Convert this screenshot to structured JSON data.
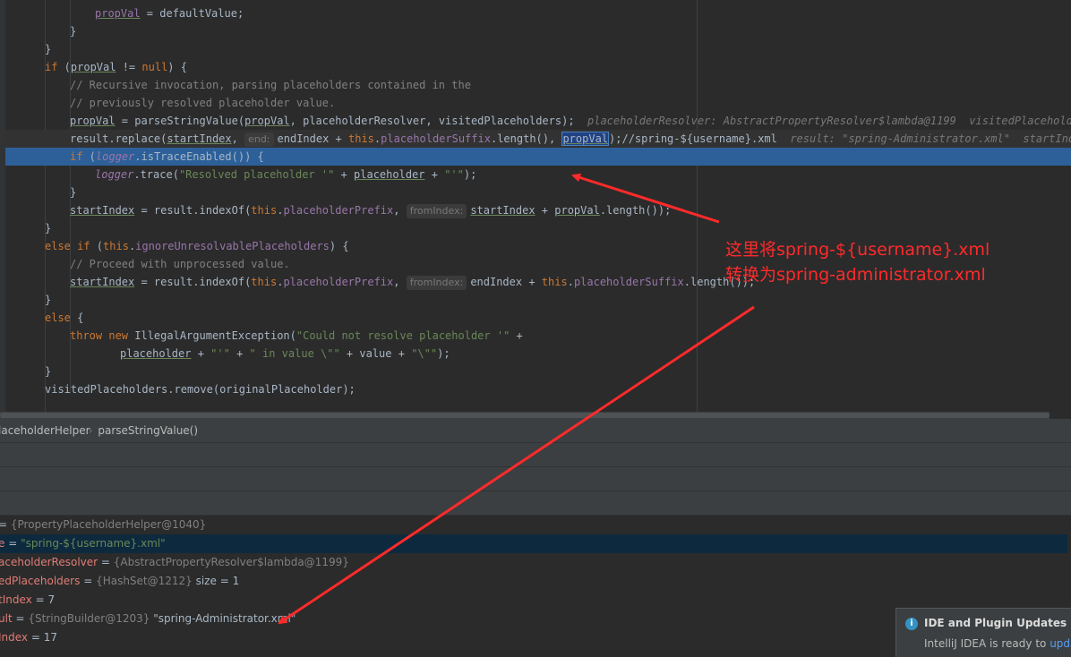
{
  "editor": {
    "lines": [
      {
        "indent": 4,
        "html_parts": [
          {
            "t": "propVal",
            "cls": "f u"
          },
          {
            "t": " = defaultValue;",
            "cls": ""
          }
        ]
      },
      {
        "indent": 3,
        "html_parts": [
          {
            "t": "}",
            "cls": ""
          }
        ]
      },
      {
        "indent": 2,
        "html_parts": [
          {
            "t": "}",
            "cls": ""
          }
        ]
      },
      {
        "indent": 2,
        "html_parts": [
          {
            "t": "if",
            "cls": "k"
          },
          {
            "t": " (",
            "cls": ""
          },
          {
            "t": "propVal",
            "cls": "u"
          },
          {
            "t": " != ",
            "cls": ""
          },
          {
            "t": "null",
            "cls": "k"
          },
          {
            "t": ") {",
            "cls": ""
          }
        ]
      },
      {
        "indent": 3,
        "html_parts": [
          {
            "t": "// Recursive invocation, parsing placeholders contained in the",
            "cls": "c"
          }
        ]
      },
      {
        "indent": 3,
        "html_parts": [
          {
            "t": "// previously resolved placeholder value.",
            "cls": "c"
          }
        ]
      },
      {
        "indent": 3,
        "html_parts": [
          {
            "t": "propVal",
            "cls": "u"
          },
          {
            "t": " = parseStringValue(",
            "cls": ""
          },
          {
            "t": "propVal",
            "cls": "u"
          },
          {
            "t": ", placeholderResolver, visitedPlaceholders);",
            "cls": ""
          },
          {
            "t": "  placeholderResolver: AbstractPropertyResolver$lambda@1199  visitedPlaceholders: ",
            "cls": "inline-val"
          }
        ]
      },
      {
        "indent": 3,
        "html_parts": [
          {
            "t": "result.replace(",
            "cls": ""
          },
          {
            "t": "startIndex",
            "cls": "u"
          },
          {
            "t": ", ",
            "cls": ""
          },
          {
            "hint": "end:"
          },
          {
            "t": "endIndex + ",
            "cls": ""
          },
          {
            "t": "this",
            "cls": "k"
          },
          {
            "t": ".",
            "cls": ""
          },
          {
            "t": "placeholderSuffix",
            "cls": "f"
          },
          {
            "t": ".length(), ",
            "cls": ""
          },
          {
            "t": "propVal",
            "cls": "u sel"
          },
          {
            "t": ");//spring-${username}.xml",
            "cls": ""
          },
          {
            "t": "  result: \"spring-Administrator.xml\"  startIndex: ",
            "cls": "inline-val"
          }
        ]
      },
      {
        "indent": 3,
        "html_parts": [
          {
            "t": "if",
            "cls": "k"
          },
          {
            "t": " (",
            "cls": ""
          },
          {
            "t": "logger",
            "cls": "fi"
          },
          {
            "t": ".isTraceEnabled()) {",
            "cls": ""
          }
        ]
      },
      {
        "indent": 4,
        "html_parts": [
          {
            "t": "logger",
            "cls": "fi"
          },
          {
            "t": ".trace(",
            "cls": ""
          },
          {
            "t": "\"Resolved placeholder '\"",
            "cls": "s"
          },
          {
            "t": " + ",
            "cls": ""
          },
          {
            "t": "placeholder",
            "cls": "u"
          },
          {
            "t": " + ",
            "cls": ""
          },
          {
            "t": "\"'\"",
            "cls": "s"
          },
          {
            "t": ");",
            "cls": ""
          }
        ]
      },
      {
        "indent": 3,
        "html_parts": [
          {
            "t": "}",
            "cls": ""
          }
        ]
      },
      {
        "indent": 3,
        "html_parts": [
          {
            "t": "startIndex",
            "cls": "u"
          },
          {
            "t": " = result.indexOf(",
            "cls": ""
          },
          {
            "t": "this",
            "cls": "k"
          },
          {
            "t": ".",
            "cls": ""
          },
          {
            "t": "placeholderPrefix",
            "cls": "f"
          },
          {
            "t": ", ",
            "cls": ""
          },
          {
            "hint": "fromIndex:"
          },
          {
            "t": "startIndex",
            "cls": "u"
          },
          {
            "t": " + ",
            "cls": ""
          },
          {
            "t": "propVal",
            "cls": "u"
          },
          {
            "t": ".length());",
            "cls": ""
          }
        ]
      },
      {
        "indent": 2,
        "html_parts": [
          {
            "t": "}",
            "cls": ""
          }
        ]
      },
      {
        "indent": 2,
        "html_parts": [
          {
            "t": "else if",
            "cls": "k"
          },
          {
            "t": " (",
            "cls": ""
          },
          {
            "t": "this",
            "cls": "k"
          },
          {
            "t": ".",
            "cls": ""
          },
          {
            "t": "ignoreUnresolvablePlaceholders",
            "cls": "f"
          },
          {
            "t": ") {",
            "cls": ""
          }
        ]
      },
      {
        "indent": 3,
        "html_parts": [
          {
            "t": "// Proceed with unprocessed value.",
            "cls": "c"
          }
        ]
      },
      {
        "indent": 3,
        "html_parts": [
          {
            "t": "startIndex",
            "cls": "u"
          },
          {
            "t": " = result.indexOf(",
            "cls": ""
          },
          {
            "t": "this",
            "cls": "k"
          },
          {
            "t": ".",
            "cls": ""
          },
          {
            "t": "placeholderPrefix",
            "cls": "f"
          },
          {
            "t": ", ",
            "cls": ""
          },
          {
            "hint": "fromIndex:"
          },
          {
            "t": "endIndex + ",
            "cls": ""
          },
          {
            "t": "this",
            "cls": "k"
          },
          {
            "t": ".",
            "cls": ""
          },
          {
            "t": "placeholderSuffix",
            "cls": "f"
          },
          {
            "t": ".length());",
            "cls": ""
          }
        ]
      },
      {
        "indent": 2,
        "html_parts": [
          {
            "t": "}",
            "cls": ""
          }
        ]
      },
      {
        "indent": 2,
        "html_parts": [
          {
            "t": "else",
            "cls": "k"
          },
          {
            "t": " {",
            "cls": ""
          }
        ]
      },
      {
        "indent": 3,
        "html_parts": [
          {
            "t": "throw new",
            "cls": "k"
          },
          {
            "t": " IllegalArgumentException(",
            "cls": ""
          },
          {
            "t": "\"Could not resolve placeholder '\"",
            "cls": "s"
          },
          {
            "t": " +",
            "cls": ""
          }
        ]
      },
      {
        "indent": 5,
        "html_parts": [
          {
            "t": "placeholder",
            "cls": "u"
          },
          {
            "t": " + ",
            "cls": ""
          },
          {
            "t": "\"'\"",
            "cls": "s"
          },
          {
            "t": " + ",
            "cls": ""
          },
          {
            "t": "\" in value \\\"\"",
            "cls": "s"
          },
          {
            "t": " + value + ",
            "cls": ""
          },
          {
            "t": "\"\\\"\"",
            "cls": "s"
          },
          {
            "t": ");",
            "cls": ""
          }
        ]
      },
      {
        "indent": 2,
        "html_parts": [
          {
            "t": "}",
            "cls": ""
          }
        ]
      },
      {
        "indent": 2,
        "html_parts": [
          {
            "t": "visitedPlaceholders.remove(originalPlaceholder);",
            "cls": ""
          }
        ]
      }
    ]
  },
  "breadcrumb": {
    "class_name": "laceholderHelper",
    "method_name": "parseStringValue()"
  },
  "variables": [
    {
      "name": "",
      "op": " = ",
      "type": "{PropertyPlaceholderHelper@1040}",
      "value": "",
      "vcls": ""
    },
    {
      "name": "e",
      "op": " = ",
      "type": "",
      "value": "\"spring-${username}.xml\"",
      "vcls": "vstr"
    },
    {
      "name": "aceholderResolver",
      "op": " = ",
      "type": "{AbstractPropertyResolver$lambda@1199}",
      "value": "",
      "vcls": ""
    },
    {
      "name": "edPlaceholders",
      "op": " = ",
      "type": "{HashSet@1212}",
      "value": "  size = 1",
      "vcls": ""
    },
    {
      "name": "tIndex",
      "op": " = ",
      "type": "",
      "value": "7",
      "vcls": ""
    },
    {
      "name": "ult",
      "op": " = ",
      "type": "{StringBuilder@1203}",
      "value": " \"spring-Administrator.xml\"",
      "vcls": ""
    },
    {
      "name": "Index",
      "op": " = ",
      "type": "",
      "value": "17",
      "vcls": ""
    }
  ],
  "annotation": {
    "line1": "这里将spring-${username}.xml",
    "line2": "转换为spring-administrator.xml"
  },
  "notification": {
    "title": "IDE and Plugin Updates",
    "body": "IntelliJ IDEA is ready to ",
    "link": "upda"
  },
  "colors": {
    "editor_bg": "#2b2b2b",
    "exec_line": "#2d6099",
    "annotation_red": "#ff2a2a"
  }
}
